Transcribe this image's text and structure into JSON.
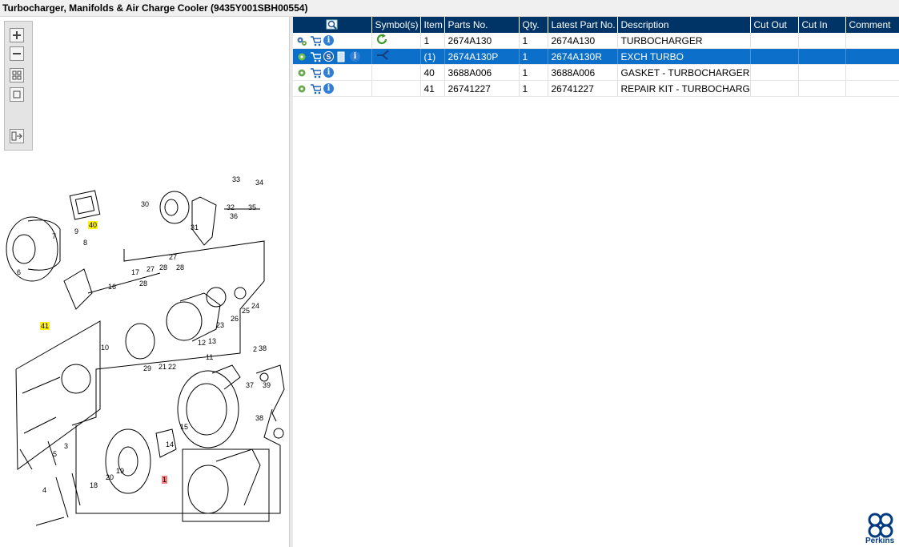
{
  "window": {
    "title": "Turbocharger, Manifolds & Air Charge Cooler (9435Y001SBH00554)"
  },
  "toolbar": {
    "buttons": [
      "zoom-in",
      "zoom-out",
      "fit-all",
      "fit-one",
      "toggle-panel"
    ]
  },
  "table": {
    "columns": [
      "",
      "Symbol(s)",
      "Item",
      "Parts No.",
      "Qty.",
      "Latest Part No.",
      "Description",
      "Cut Out",
      "Cut In",
      "Comment"
    ],
    "rows": [
      {
        "item": "1",
        "parts_no": "2674A130",
        "qty": "1",
        "latest": "2674A130",
        "description": "TURBOCHARGER",
        "cut_out": "",
        "cut_in": "",
        "comment": "",
        "selected": false
      },
      {
        "item": "(1)",
        "parts_no": "2674A130P",
        "qty": "1",
        "latest": "2674A130R",
        "description": "EXCH TURBO",
        "cut_out": "",
        "cut_in": "",
        "comment": "",
        "selected": true
      },
      {
        "item": "40",
        "parts_no": "3688A006",
        "qty": "1",
        "latest": "3688A006",
        "description": "GASKET - TURBOCHARGER",
        "cut_out": "",
        "cut_in": "",
        "comment": "",
        "selected": false
      },
      {
        "item": "41",
        "parts_no": "26741227",
        "qty": "1",
        "latest": "26741227",
        "description": "REPAIR KIT - TURBOCHARGER",
        "cut_out": "",
        "cut_in": "",
        "comment": "",
        "selected": false
      }
    ]
  },
  "diagram": {
    "callouts_highlight": [
      "40",
      "41",
      "1"
    ],
    "labels": [
      "33",
      "34",
      "30",
      "32",
      "35",
      "36",
      "31",
      "9",
      "8",
      "7",
      "6",
      "27",
      "28",
      "17",
      "16",
      "28",
      "27",
      "28",
      "25",
      "24",
      "26",
      "23",
      "29",
      "21",
      "22",
      "12",
      "13",
      "11",
      "10",
      "2",
      "38",
      "37",
      "39",
      "38",
      "15",
      "14",
      "19",
      "20",
      "18",
      "3",
      "5",
      "4"
    ]
  },
  "brand": {
    "name": "Perkins",
    "color": "#003a80"
  },
  "colors": {
    "header": "#003366",
    "selected": "#0c6fc9",
    "highlight_yellow": "#fff200",
    "highlight_red": "#f08080"
  }
}
